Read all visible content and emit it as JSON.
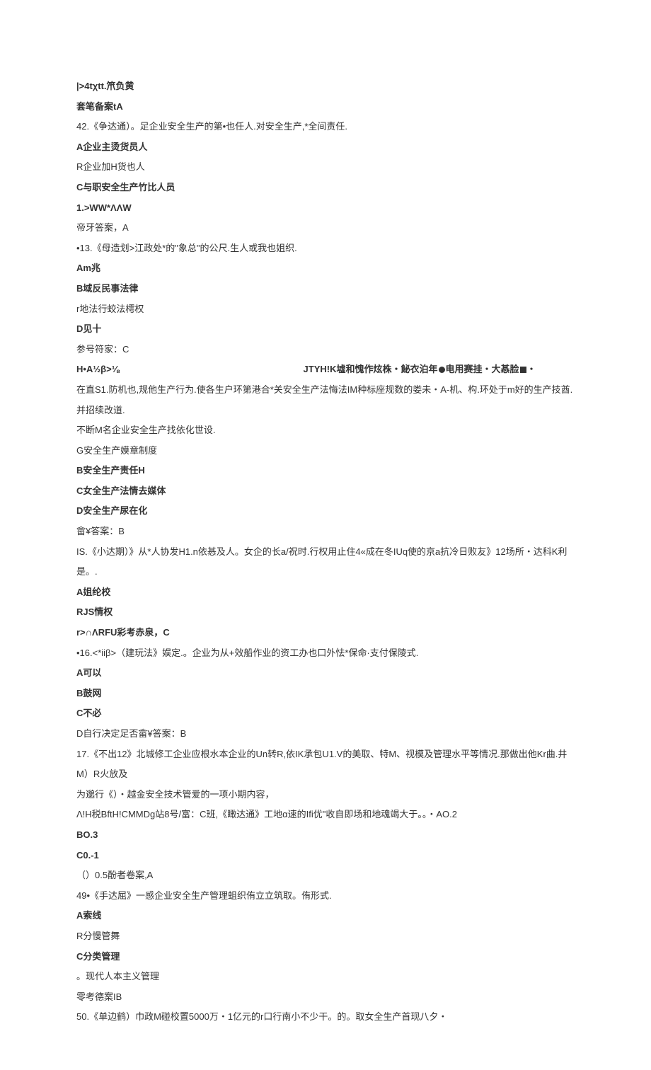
{
  "lines": [
    {
      "text": "|>4tχtt.笊负黄",
      "bold": true
    },
    {
      "text": "套笔备案tA",
      "bold": true
    },
    {
      "text": "42.《争达通）。足企业安全生产的第•也任人.对安全生产,*全间责任.",
      "bold": false
    },
    {
      "text": "A企业主烫货员人",
      "bold": true
    },
    {
      "text": "R企业加H货也人",
      "bold": false
    },
    {
      "text": "C与职安全生产竹比人员",
      "bold": true
    },
    {
      "text": "1.>WW*ΛΛW",
      "bold": true
    },
    {
      "text": "帝牙答案，A",
      "bold": false
    },
    {
      "text": "•13.《母造划>江政处*的\"象总\"的公尺.生人或我也姐织.",
      "bold": false
    },
    {
      "text": "Am兆",
      "bold": true
    },
    {
      "text": "B域反民事法律",
      "bold": true
    },
    {
      "text": "r地法行蛟法樗权",
      "bold": false
    },
    {
      "text": "D见十",
      "bold": true
    },
    {
      "text": "参号符家：C",
      "bold": false
    },
    {
      "text": "H•A½β>⅛",
      "text2": "JTYH!K墟和愧作炫株・飶衣泊年●电用赛挂・大惎脸■・",
      "bold": true,
      "split": true
    },
    {
      "text": "在直S1.防机也,规他生产行为.使各生户环第港合*关安全生产法悔法IM种标座规数的娄未・A-机、构.环处于m好的生产技酋.并招续改道.",
      "bold": false
    },
    {
      "text": "不断M名企业安全生产找依化世设.",
      "bold": false
    },
    {
      "text": "G安全生产嫫章制度",
      "bold": false
    },
    {
      "text": "B安全生产责任H",
      "bold": true
    },
    {
      "text": "C女全生产法情去媒体",
      "bold": true
    },
    {
      "text": "D安全生产尿在化",
      "bold": true
    },
    {
      "text": "畲¥答案：B",
      "bold": false
    },
    {
      "text": "IS.《小达期）》从*人协发H1.n依惎及人。女企的长a/祝时.行权用止住4«成在冬IUq使的京a抗冷日败友》12场所・达科K利是。.",
      "bold": false
    },
    {
      "text": "A姐纶校",
      "bold": true
    },
    {
      "text": "RJS情权",
      "bold": true
    },
    {
      "text": "r>∩ΛRFU彩考赤泉，C",
      "bold": true
    },
    {
      "text": "•16.<*iiβ>（建玩法》娱定.。企业为从+效船作业的资工办也口外怯*保命·支付保陵式.",
      "bold": false
    },
    {
      "text": "A可以",
      "bold": true
    },
    {
      "text": "B鼓网",
      "bold": true
    },
    {
      "text": "C不必",
      "bold": true
    },
    {
      "text": "D自行决定足否畲¥答案：B",
      "bold": false
    },
    {
      "text": "17.《不出12》北城修工企业应根水本企业的Un转R,依IK承包U1.V的美取、特M、视模及管理水平等情况.那做出他Kr曲.井M）R火放及",
      "bold": false
    },
    {
      "text": "为邈行《）・越金安全技术管爱的一项小期内容，",
      "bold": false
    },
    {
      "text": "Λ!H税BftH!CMMDg站8号/富：C班,《瞰达通》工地α速的Ifi优\"收自即场和地魂竭大于。。・AO.2",
      "bold": false
    },
    {
      "text": "BO.3",
      "bold": true
    },
    {
      "text": "C0.-1",
      "bold": true
    },
    {
      "text": "（）0.5酚者卷案,A",
      "bold": false
    },
    {
      "text": "49•《手达屈》一感企业安全生产管理蛆织侑立立筑取。侑形式.",
      "bold": false
    },
    {
      "text": "A索线",
      "bold": true
    },
    {
      "text": "R分慢管舞",
      "bold": false
    },
    {
      "text": "C分类管理",
      "bold": true
    },
    {
      "text": "。现代人本主义管理",
      "bold": false
    },
    {
      "text": "零考德案IB",
      "bold": false
    },
    {
      "text": "50.《单边鹤）巾政M碰校置5000万・1亿元的r口行南小不少干。的。取女全生产首现八夕・",
      "bold": false
    }
  ]
}
